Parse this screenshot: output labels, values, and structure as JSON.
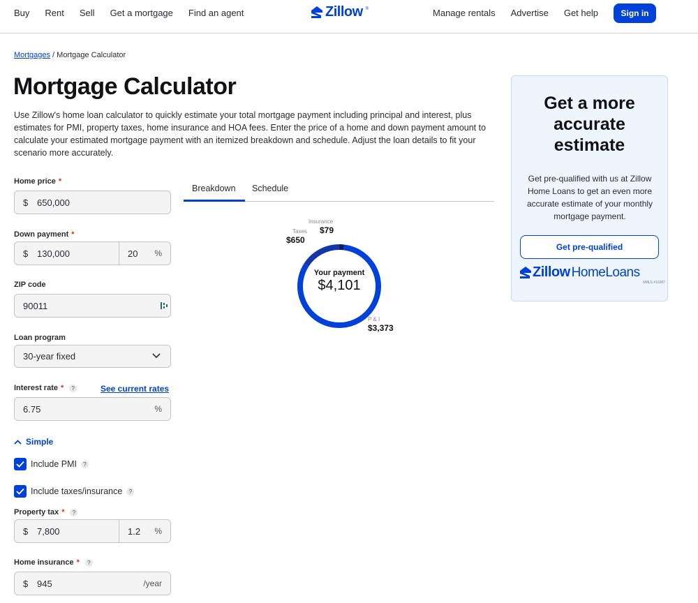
{
  "nav": {
    "left": [
      "Buy",
      "Rent",
      "Sell",
      "Get a mortgage",
      "Find an agent"
    ],
    "right": [
      "Manage rentals",
      "Advertise",
      "Get help"
    ],
    "sign_in": "Sign in",
    "logo_text": "Zillow",
    "logo_mark": "®"
  },
  "breadcrumb": {
    "link": "Mortgages",
    "sep": " / ",
    "current": "Mortgage Calculator"
  },
  "title": "Mortgage Calculator",
  "intro": "Use Zillow's home loan calculator to quickly estimate your total mortgage payment including principal and interest, plus estimates for PMI, property taxes, home insurance and HOA fees. Enter the price of a home and down payment amount to calculate your estimated mortgage payment with an itemized breakdown and schedule. Adjust the loan details to fit your scenario more accurately.",
  "form": {
    "home_price": {
      "label": "Home price",
      "req": "*",
      "prefix": "$",
      "value": "650,000"
    },
    "down_payment": {
      "label": "Down payment",
      "req": "*",
      "prefix": "$",
      "value": "130,000",
      "percent": "20",
      "percent_suffix": "%"
    },
    "zip": {
      "label": "ZIP code",
      "value": "90011"
    },
    "loan_program": {
      "label": "Loan program",
      "value": "30-year fixed"
    },
    "interest_rate": {
      "label": "Interest rate",
      "req": "*",
      "help": "?",
      "link": "See current rates",
      "value": "6.75",
      "suffix": "%"
    },
    "simple_toggle": "Simple",
    "include_pmi": {
      "label": "Include PMI",
      "help": "?"
    },
    "include_taxes": {
      "label": "Include taxes/insurance",
      "help": "?"
    },
    "property_tax": {
      "label": "Property tax",
      "req": "*",
      "help": "?",
      "prefix": "$",
      "value": "7,800",
      "percent": "1.2",
      "percent_suffix": "%"
    },
    "home_insurance": {
      "label": "Home insurance",
      "req": "*",
      "help": "?",
      "prefix": "$",
      "value": "945",
      "suffix": "/year"
    }
  },
  "tabs": [
    "Breakdown",
    "Schedule"
  ],
  "breakdown": {
    "center_label": "Your payment",
    "center_value": "$4,101",
    "segments": [
      {
        "label": "P & I",
        "value": "$3,373",
        "amount": 3373,
        "color": "#0041d9"
      },
      {
        "label": "Taxes",
        "value": "$650",
        "amount": 650,
        "color": "#1337a8"
      },
      {
        "label": "Insurance",
        "value": "$79",
        "amount": 79,
        "color": "#0d1f5c"
      }
    ]
  },
  "card": {
    "title_lines": [
      "Get a more",
      "accurate",
      "estimate"
    ],
    "body": "Get pre-qualified with us at Zillow Home Loans to get an even more accurate estimate of your monthly mortgage payment.",
    "button": "Get pre-qualified",
    "logo_zillow": "Zillow",
    "logo_home": "HomeLoans",
    "nmls": "NMLS #10287"
  },
  "colors": {
    "brand": "#0041d9",
    "required": "#d1361a"
  }
}
